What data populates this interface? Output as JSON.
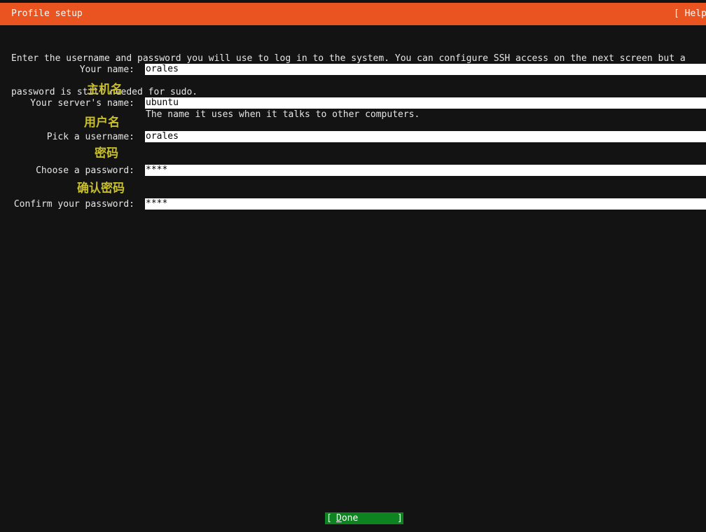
{
  "header": {
    "title": "Profile setup",
    "help": "[ Help"
  },
  "intro": {
    "line1": "Enter the username and password you will use to log in to the system. You can configure SSH access on the next screen but a",
    "line2": "password is still needed for sudo."
  },
  "form": {
    "name": {
      "label": "Your name:",
      "value": "orales"
    },
    "server": {
      "annotation": "主机名",
      "label": "Your server's name:",
      "value": "ubuntu",
      "hint": "The name it uses when it talks to other computers."
    },
    "username": {
      "annotation": "用户名",
      "label": "Pick a username:",
      "value": "orales"
    },
    "password": {
      "annotation": "密码",
      "label": "Choose a password:",
      "value": "****"
    },
    "confirm": {
      "annotation": "确认密码",
      "label": "Confirm your password:",
      "value": "****"
    }
  },
  "footer": {
    "done": {
      "bracket_left": "[",
      "label_first": "D",
      "label_rest": "one",
      "bracket_right": "]"
    }
  },
  "colors": {
    "header_bg": "#e95420",
    "background": "#131313",
    "field_bg": "#ffffff",
    "done_bg": "#0e8420",
    "annotation": "#c8bf2a"
  }
}
